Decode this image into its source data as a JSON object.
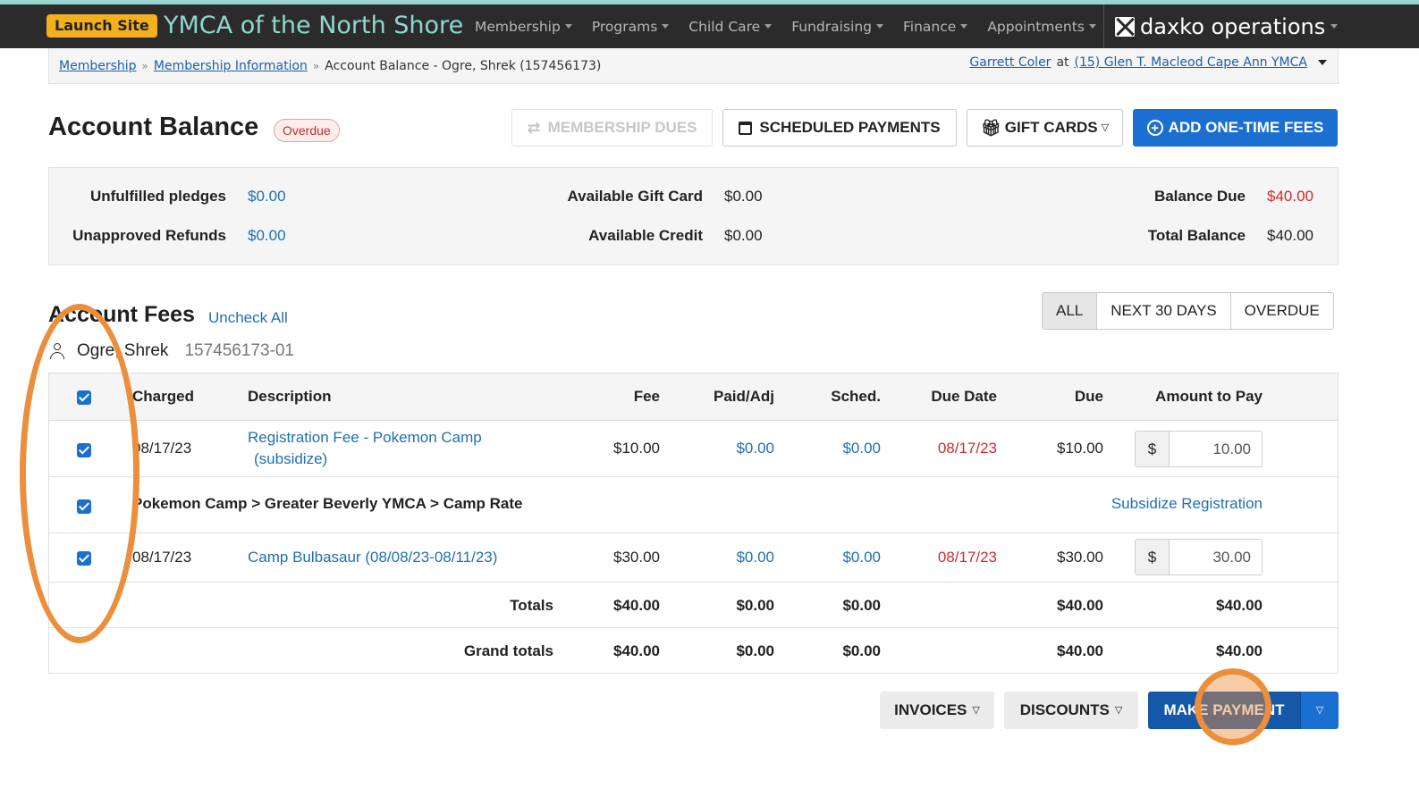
{
  "topbar": {
    "launch_label": "Launch Site",
    "org_name": "YMCA of the North Shore",
    "nav": [
      "Membership",
      "Programs",
      "Child Care",
      "Fundraising",
      "Finance",
      "Appointments"
    ],
    "brand": "daxko operations",
    "accent_color": "#8fd8cf"
  },
  "breadcrumb": {
    "items": [
      "Membership",
      "Membership Information"
    ],
    "current": "Account Balance - Ogre, Shrek (157456173)",
    "user": "Garrett Coler",
    "at": "at",
    "location": "(15) Glen T. Macleod Cape Ann YMCA"
  },
  "page": {
    "title": "Account Balance",
    "status_badge": "Overdue",
    "actions": {
      "membership_dues": "MEMBERSHIP DUES",
      "scheduled_payments": "SCHEDULED PAYMENTS",
      "gift_cards": "GIFT CARDS",
      "add_fees": "ADD ONE-TIME FEES"
    }
  },
  "summary": {
    "unfulfilled_pledges_label": "Unfulfilled pledges",
    "unfulfilled_pledges": "$0.00",
    "unapproved_refunds_label": "Unapproved Refunds",
    "unapproved_refunds": "$0.00",
    "available_gift_card_label": "Available Gift Card",
    "available_gift_card": "$0.00",
    "available_credit_label": "Available Credit",
    "available_credit": "$0.00",
    "balance_due_label": "Balance Due",
    "balance_due": "$40.00",
    "total_balance_label": "Total Balance",
    "total_balance": "$40.00"
  },
  "fees": {
    "title": "Account Fees",
    "uncheck_all": "Uncheck All",
    "member_name": "Ogre, Shrek",
    "member_id": "157456173-01",
    "filters": [
      "ALL",
      "NEXT 30 DAYS",
      "OVERDUE"
    ],
    "columns": {
      "charged": "Charged",
      "description": "Description",
      "fee": "Fee",
      "paid": "Paid/Adj",
      "sched": "Sched.",
      "due_date": "Due Date",
      "due": "Due",
      "amount": "Amount to Pay"
    },
    "rows": [
      {
        "charged": "08/17/23",
        "description_line1": "Registration Fee - Pokemon Camp",
        "description_line2": "(subsidize)",
        "fee": "$10.00",
        "paid": "$0.00",
        "sched": "$0.00",
        "due_date": "08/17/23",
        "due": "$10.00",
        "currency": "$",
        "amount": "10.00"
      },
      {
        "charged": "08/17/23",
        "description": "Camp Bulbasaur (08/08/23-08/11/23)",
        "fee": "$30.00",
        "paid": "$0.00",
        "sched": "$0.00",
        "due_date": "08/17/23",
        "due": "$30.00",
        "currency": "$",
        "amount": "30.00"
      }
    ],
    "group_label": "Pokemon Camp > Greater Beverly YMCA > Camp Rate",
    "group_link": "Subsidize Registration",
    "totals": {
      "label": "Totals",
      "fee": "$40.00",
      "paid": "$0.00",
      "sched": "$0.00",
      "due": "$40.00",
      "amount": "$40.00"
    },
    "grand_totals": {
      "label": "Grand totals",
      "fee": "$40.00",
      "paid": "$0.00",
      "sched": "$0.00",
      "due": "$40.00",
      "amount": "$40.00"
    }
  },
  "footer_actions": {
    "invoices": "INVOICES",
    "discounts": "DISCOUNTS",
    "make_payment": "MAKE PAYMENT"
  }
}
